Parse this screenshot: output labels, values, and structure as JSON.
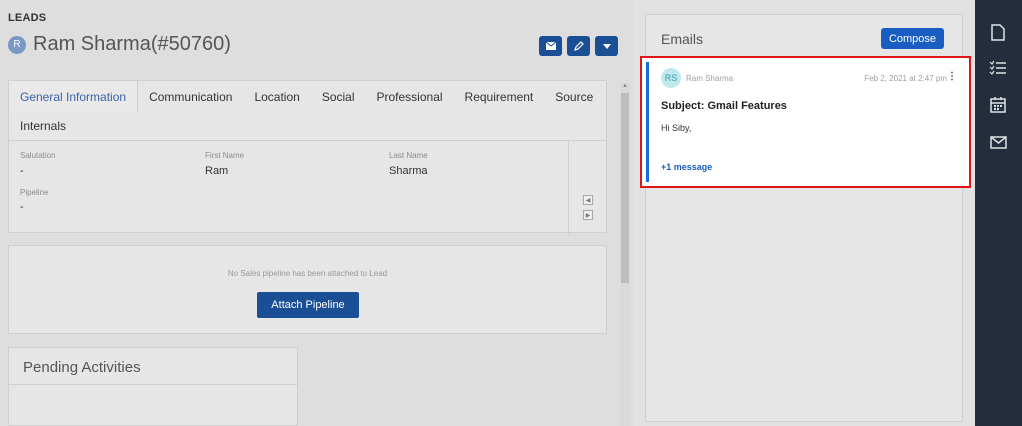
{
  "breadcrumb": "LEADS",
  "lead": {
    "avatar": "R",
    "title": "Ram Sharma(#50760)"
  },
  "header_actions": [
    {
      "name": "email-icon"
    },
    {
      "name": "pencil-icon"
    },
    {
      "name": "caret-down-icon"
    }
  ],
  "tabs": [
    "General Information",
    "Communication",
    "Location",
    "Social",
    "Professional",
    "Requirement",
    "Source",
    "Internals"
  ],
  "fields": {
    "salutation": {
      "label": "Salutation",
      "value": "-"
    },
    "first_name": {
      "label": "First Name",
      "value": "Ram"
    },
    "last_name": {
      "label": "Last Name",
      "value": "Sharma"
    },
    "pipeline": {
      "label": "Pipeline",
      "value": "-"
    }
  },
  "pipeline_card": {
    "message": "No Sales pipeline has been attached to Lead",
    "button": "Attach Pipeline"
  },
  "pending": {
    "title": "Pending Activities"
  },
  "emails": {
    "title": "Emails",
    "compose": "Compose",
    "message": {
      "avatar": "RS",
      "from": "Ram Sharma",
      "date": "Feb 2, 2021 at 2:47 pm",
      "subject": "Subject: Gmail Features",
      "body": "Hi Siby,",
      "more": "+1 message"
    }
  },
  "rail_icons": [
    "document-icon",
    "checklist-icon",
    "calendar-icon",
    "mail-icon"
  ],
  "colors": {
    "primary": "#1a4f96",
    "compose": "#1a5dc2",
    "highlight": "#e01515",
    "rail": "#232d3b"
  }
}
